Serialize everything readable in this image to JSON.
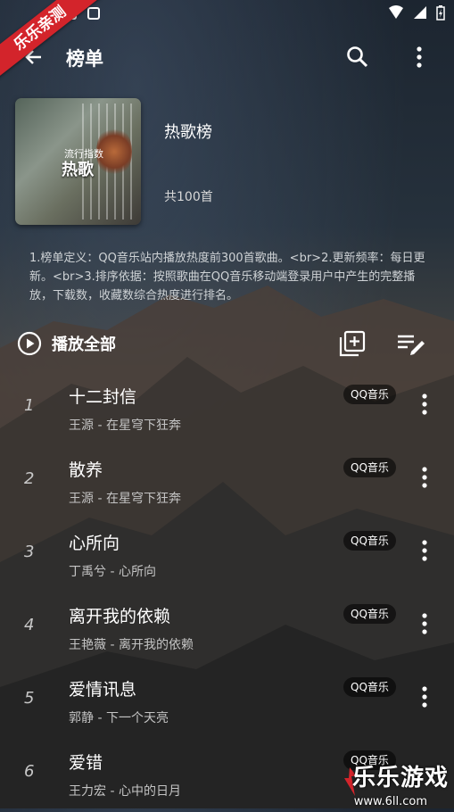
{
  "watermark_ribbon": "乐乐亲测",
  "appbar": {
    "title": "榜单"
  },
  "playlist": {
    "cover_sub": "流行指数",
    "cover_title": "热歌",
    "name": "热歌榜",
    "count": "共100首",
    "description": "1.榜单定义：QQ音乐站内播放热度前300首歌曲。<br>2.更新频率：每日更新。<br>3.排序依据：按照歌曲在QQ音乐移动端登录用户中产生的完整播放，下载数，收藏数综合热度进行排名。"
  },
  "actions": {
    "play_all": "播放全部"
  },
  "songs": [
    {
      "num": "1",
      "title": "十二封信",
      "artist": "王源 - 在星穹下狂奔",
      "source": "QQ音乐"
    },
    {
      "num": "2",
      "title": "散养",
      "artist": "王源 - 在星穹下狂奔",
      "source": "QQ音乐"
    },
    {
      "num": "3",
      "title": "心所向",
      "artist": "丁禹兮 - 心所向",
      "source": "QQ音乐"
    },
    {
      "num": "4",
      "title": "离开我的依赖",
      "artist": "王艳薇 - 离开我的依赖",
      "source": "QQ音乐"
    },
    {
      "num": "5",
      "title": "爱情讯息",
      "artist": "郭静 - 下一个天亮",
      "source": "QQ音乐"
    },
    {
      "num": "6",
      "title": "爱错",
      "artist": "王力宏 - 心中的日月",
      "source": "QQ音乐"
    }
  ],
  "watermark": {
    "brand": "乐乐游戏",
    "url": "www.6ll.com"
  },
  "icons": {
    "back": "arrow-left-icon",
    "search": "search-icon",
    "more": "more-vertical-icon",
    "play": "play-circle-icon",
    "add_to_list": "playlist-add-icon",
    "edit_list": "playlist-edit-icon"
  },
  "colors": {
    "ribbon": "#d3242b",
    "badge_bg": "#000000"
  }
}
